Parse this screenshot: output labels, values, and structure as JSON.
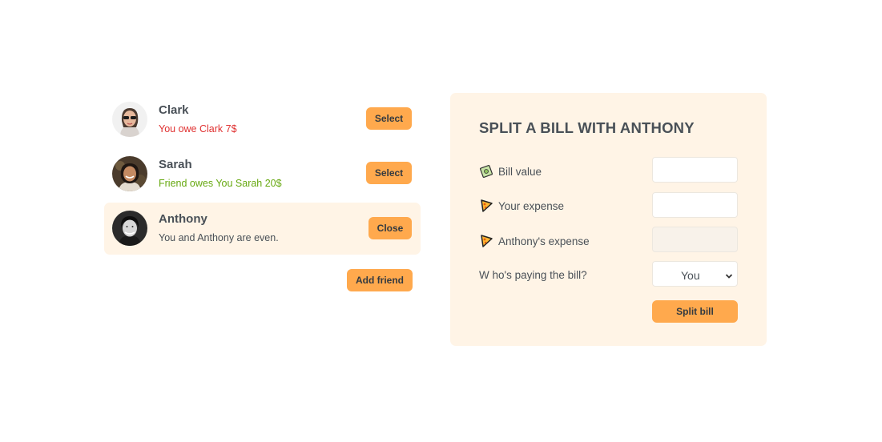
{
  "friends": [
    {
      "name": "Clark",
      "status": "You owe Clark 7$",
      "status_tone": "negative",
      "button": "Select",
      "avatar_icon": "avatar-clark"
    },
    {
      "name": "Sarah",
      "status": "Friend owes You Sarah 20$",
      "status_tone": "positive",
      "button": "Select",
      "avatar_icon": "avatar-sarah"
    },
    {
      "name": "Anthony",
      "status": "You and Anthony are even.",
      "status_tone": "neutral",
      "button": "Close",
      "avatar_icon": "avatar-anthony",
      "selected": true
    }
  ],
  "add_friend_label": "Add friend",
  "form": {
    "title": "SPLIT A BILL WITH ANTHONY",
    "bill_value_label": "Bill value",
    "bill_value": "",
    "your_expense_label": "Your expense",
    "your_expense": "",
    "friend_expense_label": "Anthony's expense",
    "friend_expense": "",
    "payer_label": "W ho's paying the bill?",
    "payer_selected": "You",
    "submit_label": "Split bill"
  },
  "colors": {
    "accent": "#ffa94d",
    "panel": "#fff4e6",
    "negative": "#e03131",
    "positive": "#66a80f"
  }
}
